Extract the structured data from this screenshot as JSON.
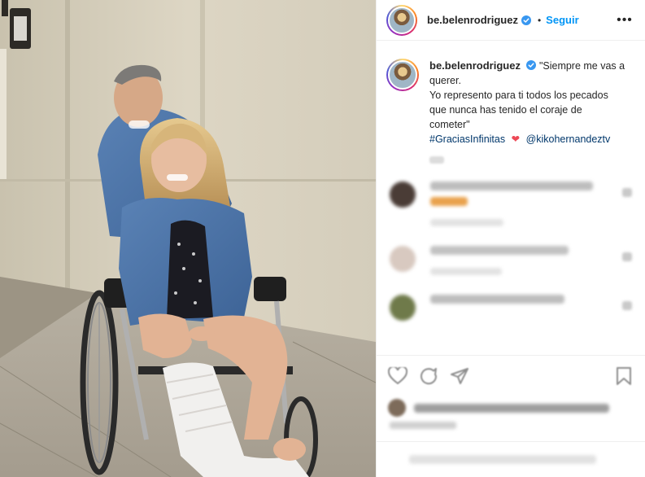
{
  "post": {
    "username": "be.belenrodriguez",
    "follow_label": "Seguir",
    "separator": "•",
    "more_label": "•••",
    "caption": {
      "line1": "\"Siempre me vas a",
      "line2": "querer.",
      "line3": "Yo represento para ti todos los pecados",
      "line4": "que nunca has tenido el coraje de",
      "line5": "cometer\"",
      "hashtag": "#GraciasInfinitas",
      "heart": "❤",
      "mention": "@kikohernandeztv"
    }
  },
  "colors": {
    "accent": "#0095f6",
    "link": "#00376b",
    "verified": "#3897f0",
    "heart": "#ed4956"
  },
  "icons": [
    "verified-badge-icon",
    "more-options-icon",
    "heart-icon",
    "comment-icon",
    "share-icon",
    "bookmark-icon"
  ]
}
